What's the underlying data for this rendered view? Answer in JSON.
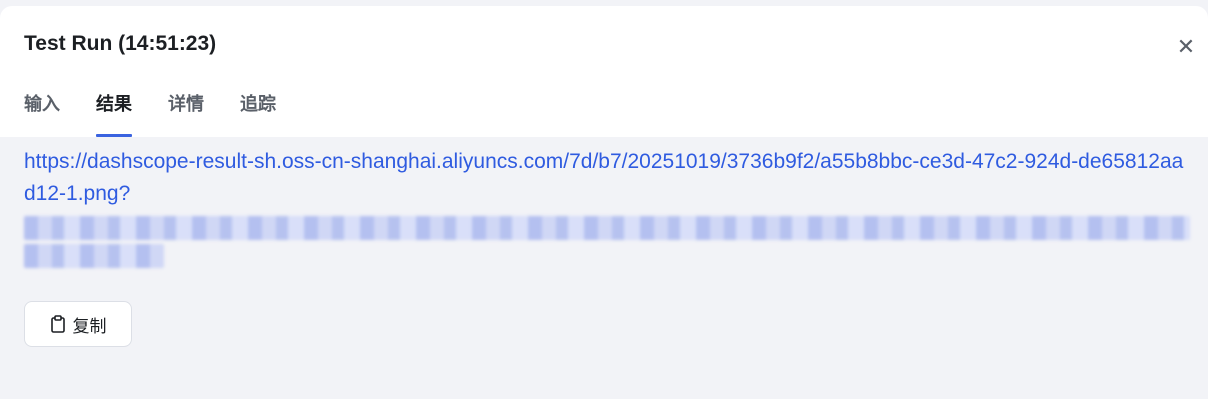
{
  "dialog": {
    "title": "Test Run (14:51:23)",
    "close_icon": "close-icon"
  },
  "tabs": [
    {
      "label": "输入",
      "active": false
    },
    {
      "label": "结果",
      "active": true
    },
    {
      "label": "详情",
      "active": false
    },
    {
      "label": "追踪",
      "active": false
    }
  ],
  "result": {
    "url": "https://dashscope-result-sh.oss-cn-shanghai.aliyuncs.com/7d/b7/20251019/3736b9f2/a55b8bbc-ce3d-47c2-924d-de65812aad12-1.png?"
  },
  "copy_button": {
    "label": "复制",
    "icon": "clipboard-icon"
  },
  "colors": {
    "accent": "#3a63e0",
    "link": "#2f5be0",
    "background": "#f2f3f7"
  }
}
